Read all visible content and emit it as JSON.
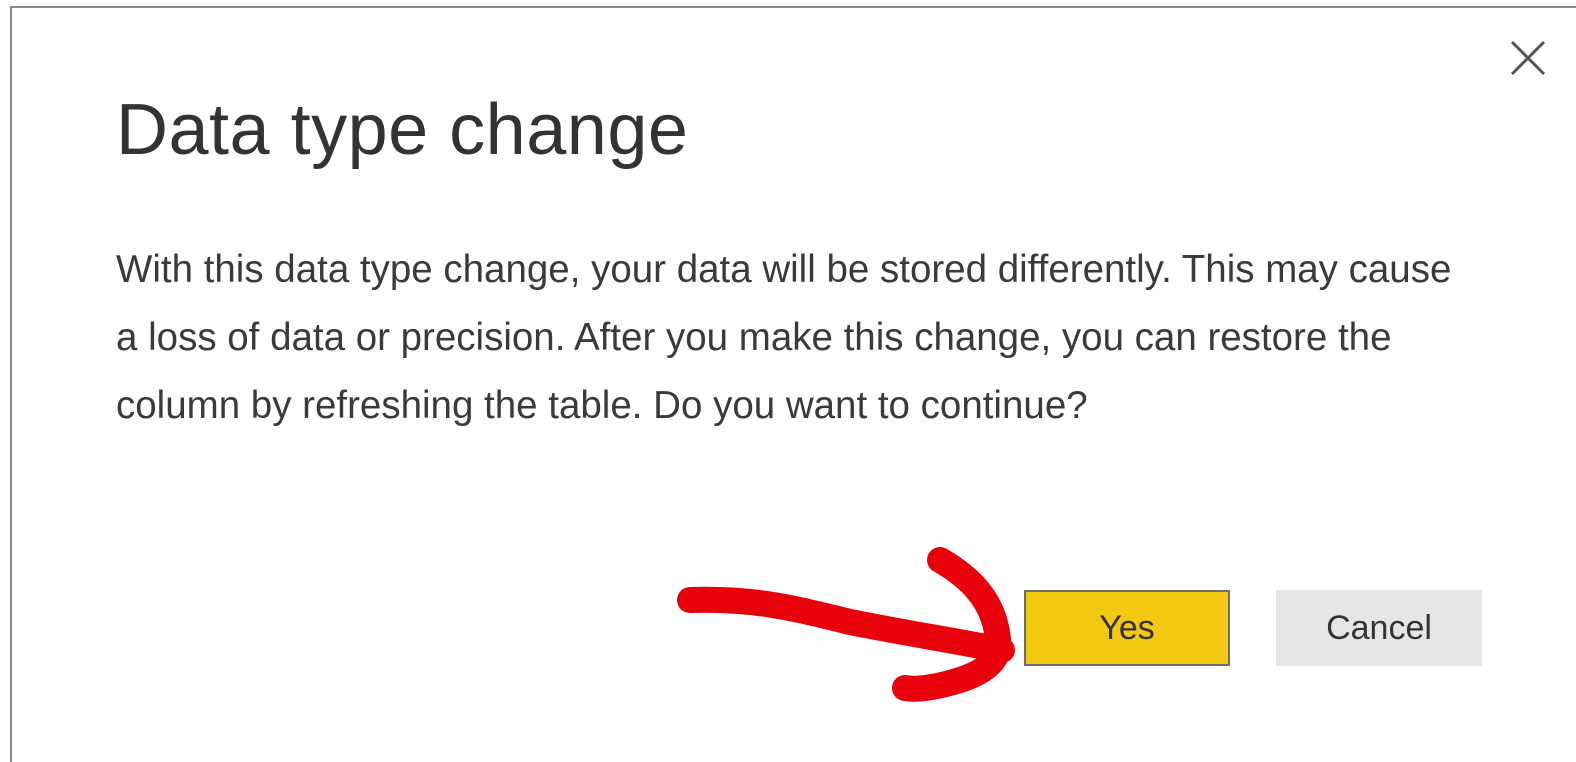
{
  "dialog": {
    "title": "Data type change",
    "message": "With this data type change, your data will be stored differently. This may cause a loss of data or precision. After you make this change, you can restore the column by refreshing the table. Do you want to continue?",
    "close_icon": "close-icon",
    "buttons": {
      "yes_label": "Yes",
      "cancel_label": "Cancel"
    }
  },
  "annotation": {
    "type": "hand-drawn arrow pointing at Yes button",
    "color": "#e8000b"
  },
  "colors": {
    "primary_button": "#f2c811",
    "secondary_button": "#e6e6e6",
    "text": "#333333"
  }
}
